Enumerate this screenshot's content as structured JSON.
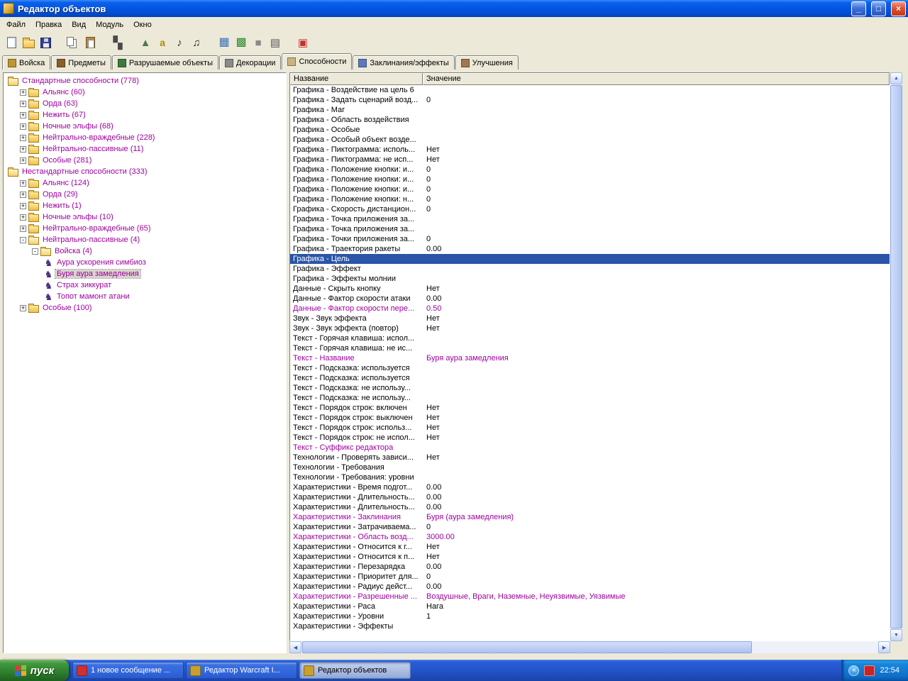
{
  "window": {
    "title": "Редактор объектов"
  },
  "glyphs": {
    "minimize": "_",
    "maximize": "□",
    "close": "×",
    "scroll_up": "▲",
    "scroll_down": "▼",
    "scroll_left": "◀",
    "scroll_right": "▶",
    "tray_chevron": "«",
    "expander_plus": "+",
    "expander_minus": "-",
    "ability": "♞"
  },
  "menu": {
    "items": [
      {
        "id": "file",
        "label": "Файл"
      },
      {
        "id": "edit",
        "label": "Правка"
      },
      {
        "id": "view",
        "label": "Вид"
      },
      {
        "id": "module",
        "label": "Модуль"
      },
      {
        "id": "window",
        "label": "Окно"
      }
    ]
  },
  "toolbar": {
    "buttons": [
      {
        "id": "new-map",
        "icon": "new",
        "glyph": ""
      },
      {
        "id": "open-map",
        "icon": "open",
        "glyph": ""
      },
      {
        "id": "save-map",
        "icon": "save",
        "glyph": ""
      },
      {
        "id": "copy",
        "icon": "copy",
        "glyph": "",
        "gap": true
      },
      {
        "id": "paste",
        "icon": "paste",
        "glyph": ""
      },
      {
        "id": "pathing-checker",
        "icon": "checker",
        "glyph": "▚",
        "gap": true
      },
      {
        "id": "terrain-editor",
        "icon": "terrain",
        "glyph": "▲",
        "gap": true
      },
      {
        "id": "script-editor",
        "icon": "script",
        "glyph": "a"
      },
      {
        "id": "sound-editor",
        "icon": "sound",
        "glyph": "♪"
      },
      {
        "id": "sound-manager",
        "icon": "sound2",
        "glyph": "♫"
      },
      {
        "id": "object-editor",
        "icon": "object",
        "glyph": "▦",
        "gap": true
      },
      {
        "id": "campaign-editor",
        "icon": "campaign",
        "glyph": "▩"
      },
      {
        "id": "ai-editor",
        "icon": "cube",
        "glyph": "■"
      },
      {
        "id": "object-manager",
        "icon": "manager",
        "glyph": "▤"
      },
      {
        "id": "import-manager",
        "icon": "import",
        "glyph": "▣",
        "gap": true
      }
    ]
  },
  "tabs": [
    {
      "id": "units",
      "label": "Войска",
      "icon_color": "#BE9530",
      "active": false
    },
    {
      "id": "items",
      "label": "Предметы",
      "icon_color": "#8B5E2B",
      "active": false
    },
    {
      "id": "destructibles",
      "label": "Разрушаемые объекты",
      "icon_color": "#3E7A3E",
      "active": false
    },
    {
      "id": "doodads",
      "label": "Декорации",
      "icon_color": "#8A8A8A",
      "active": false
    },
    {
      "id": "abilities",
      "label": "Способности",
      "icon_color": "#C9B37E",
      "active": true
    },
    {
      "id": "buffs",
      "label": "Заклинания/эффекты",
      "icon_color": "#5A7AC0",
      "active": false
    },
    {
      "id": "upgrades",
      "label": "Улучшения",
      "icon_color": "#A07850",
      "active": false
    }
  ],
  "tree": {
    "items": [
      {
        "depth": 0,
        "icon": "folder-open",
        "expander": null,
        "label": "Стандартные способности (778)"
      },
      {
        "depth": 1,
        "icon": "folder",
        "expander": "plus",
        "label": "Альянс (60)"
      },
      {
        "depth": 1,
        "icon": "folder",
        "expander": "plus",
        "label": "Орда (63)"
      },
      {
        "depth": 1,
        "icon": "folder",
        "expander": "plus",
        "label": "Нежить (67)"
      },
      {
        "depth": 1,
        "icon": "folder",
        "expander": "plus",
        "label": "Ночные эльфы (68)"
      },
      {
        "depth": 1,
        "icon": "folder",
        "expander": "plus",
        "label": "Нейтрально-враждебные (228)"
      },
      {
        "depth": 1,
        "icon": "folder",
        "expander": "plus",
        "label": "Нейтрально-пассивные (11)"
      },
      {
        "depth": 1,
        "icon": "folder",
        "expander": "plus",
        "label": "Особые (281)"
      },
      {
        "depth": 0,
        "icon": "folder-open",
        "expander": null,
        "label": "Нестандартные способности (333)"
      },
      {
        "depth": 1,
        "icon": "folder",
        "expander": "plus",
        "label": "Альянс (124)"
      },
      {
        "depth": 1,
        "icon": "folder",
        "expander": "plus",
        "label": "Орда (29)"
      },
      {
        "depth": 1,
        "icon": "folder",
        "expander": "plus",
        "label": "Нежить (1)"
      },
      {
        "depth": 1,
        "icon": "folder",
        "expander": "plus",
        "label": "Ночные эльфы (10)"
      },
      {
        "depth": 1,
        "icon": "folder",
        "expander": "plus",
        "label": "Нейтрально-враждебные (65)"
      },
      {
        "depth": 1,
        "icon": "folder-open",
        "expander": "minus",
        "label": "Нейтрально-пассивные (4)"
      },
      {
        "depth": 2,
        "icon": "folder-open",
        "expander": "minus",
        "label": "Войска (4)"
      },
      {
        "depth": 3,
        "icon": "ability",
        "expander": null,
        "label": "Аура ускорения симбиоз"
      },
      {
        "depth": 3,
        "icon": "ability",
        "expander": null,
        "label": "Буря аура замедления",
        "selected": true
      },
      {
        "depth": 3,
        "icon": "ability",
        "expander": null,
        "label": "Страх зиккурат"
      },
      {
        "depth": 3,
        "icon": "ability",
        "expander": null,
        "label": "Топот мамонт атани"
      },
      {
        "depth": 1,
        "icon": "folder",
        "expander": "plus",
        "label": "Особые (100)"
      }
    ]
  },
  "table": {
    "columns": [
      "Название",
      "Значение"
    ],
    "rows": [
      {
        "name": "Графика - Воздействие на цель 6",
        "value": ""
      },
      {
        "name": "Графика - Задать сценарий возд...",
        "value": "0"
      },
      {
        "name": "Графика - Маг",
        "value": ""
      },
      {
        "name": "Графика - Область воздействия",
        "value": ""
      },
      {
        "name": "Графика - Особые",
        "value": ""
      },
      {
        "name": "Графика - Особый объект возде...",
        "value": ""
      },
      {
        "name": "Графика - Пиктограмма: исполь...",
        "value": "Нет"
      },
      {
        "name": "Графика - Пиктограмма: не исп...",
        "value": "Нет"
      },
      {
        "name": "Графика - Положение кнопки: и...",
        "value": "0"
      },
      {
        "name": "Графика - Положение кнопки: и...",
        "value": "0"
      },
      {
        "name": "Графика - Положение кнопки: и...",
        "value": "0"
      },
      {
        "name": "Графика - Положение кнопки: н...",
        "value": "0"
      },
      {
        "name": "Графика - Скорость дистанцион...",
        "value": "0"
      },
      {
        "name": "Графика - Точка приложения за...",
        "value": ""
      },
      {
        "name": "Графика - Точка приложения за...",
        "value": ""
      },
      {
        "name": "Графика - Точки приложения за...",
        "value": "0"
      },
      {
        "name": "Графика - Траектория ракеты",
        "value": "0.00"
      },
      {
        "name": "Графика - Цель",
        "value": "",
        "selected": true
      },
      {
        "name": "Графика - Эффект",
        "value": ""
      },
      {
        "name": "Графика - Эффекты молнии",
        "value": ""
      },
      {
        "name": "Данные - Скрыть кнопку",
        "value": "Нет"
      },
      {
        "name": "Данные - Фактор скорости атаки",
        "value": "0.00"
      },
      {
        "name": "Данные - Фактор скорости пере...",
        "value": "0.50",
        "modified": true
      },
      {
        "name": "Звук - Звук эффекта",
        "value": "Нет"
      },
      {
        "name": "Звук - Звук эффекта (повтор)",
        "value": "Нет"
      },
      {
        "name": "Текст - Горячая клавиша: испол...",
        "value": ""
      },
      {
        "name": "Текст - Горячая клавиша: не ис...",
        "value": ""
      },
      {
        "name": "Текст - Название",
        "value": "Буря аура замедления",
        "modified": true
      },
      {
        "name": "Текст - Подсказка: используется",
        "value": ""
      },
      {
        "name": "Текст - Подсказка: используется",
        "value": ""
      },
      {
        "name": "Текст - Подсказка: не использу...",
        "value": ""
      },
      {
        "name": "Текст - Подсказка: не использу...",
        "value": ""
      },
      {
        "name": "Текст - Порядок строк: включен",
        "value": "Нет"
      },
      {
        "name": "Текст - Порядок строк: выключен",
        "value": "Нет"
      },
      {
        "name": "Текст - Порядок строк: использ...",
        "value": "Нет"
      },
      {
        "name": "Текст - Порядок строк: не испол...",
        "value": "Нет"
      },
      {
        "name": "Текст - Суффикс редактора",
        "value": "",
        "modified": true
      },
      {
        "name": "Технологии - Проверять зависи...",
        "value": "Нет"
      },
      {
        "name": "Технологии - Требования",
        "value": ""
      },
      {
        "name": "Технологии - Требования: уровни",
        "value": ""
      },
      {
        "name": "Характеристики - Время подгот...",
        "value": "0.00"
      },
      {
        "name": "Характеристики - Длительность...",
        "value": "0.00"
      },
      {
        "name": "Характеристики - Длительность...",
        "value": "0.00"
      },
      {
        "name": "Характеристики - Заклинания",
        "value": "Буря (аура замедления)",
        "modified": true
      },
      {
        "name": "Характеристики - Затрачиваема...",
        "value": "0"
      },
      {
        "name": "Характеристики - Область возд...",
        "value": "3000.00",
        "modified": true
      },
      {
        "name": "Характеристики - Относится к г...",
        "value": "Нет"
      },
      {
        "name": "Характеристики - Относится к п...",
        "value": "Нет"
      },
      {
        "name": "Характеристики - Перезарядка",
        "value": "0.00"
      },
      {
        "name": "Характеристики - Приоритет для...",
        "value": "0"
      },
      {
        "name": "Характеристики - Радиус дейст...",
        "value": "0.00"
      },
      {
        "name": "Характеристики - Разрешенные ...",
        "value": "Воздушные, Враги, Наземные, Неуязвимые, Уязвимые",
        "modified": true
      },
      {
        "name": "Характеристики - Раса",
        "value": "Нага"
      },
      {
        "name": "Характеристики - Уровни",
        "value": "1"
      },
      {
        "name": "Характеристики - Эффекты",
        "value": ""
      }
    ]
  },
  "taskbar": {
    "start_label": "пуск",
    "clock": "22:54",
    "buttons": [
      {
        "id": "new-message",
        "label": "1 новое сообщение ...",
        "icon": "message",
        "icon_color": "#D03030",
        "active": false
      },
      {
        "id": "warcraft-editor",
        "label": "Редактор Warcraft I...",
        "icon": "warcraft-editor",
        "icon_color": "#C8A030",
        "active": false
      },
      {
        "id": "object-editor",
        "label": "Редактор объектов",
        "icon": "object-editor",
        "icon_color": "#C8A030",
        "active": true
      }
    ],
    "tray_icons": [
      {
        "id": "tray-app",
        "icon_color": "#CC2222"
      }
    ]
  }
}
